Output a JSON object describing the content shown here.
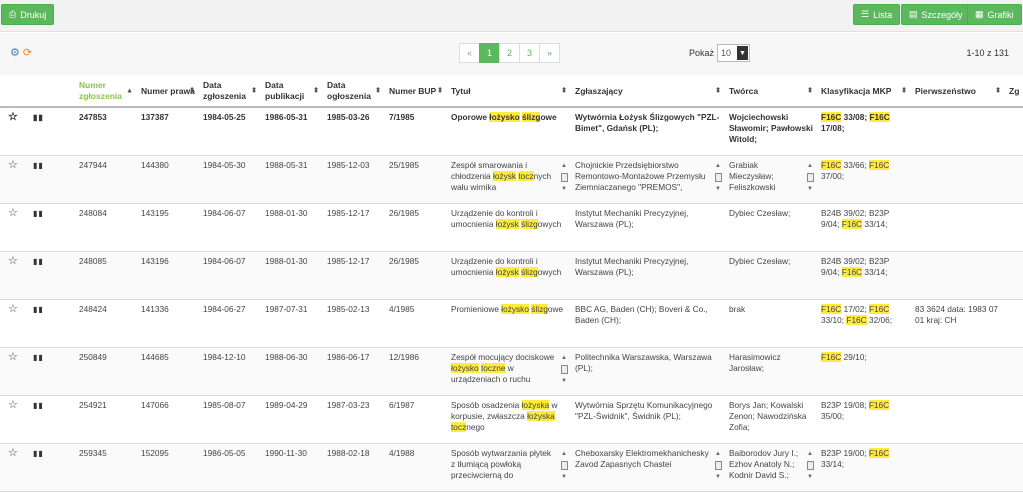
{
  "topbar": {
    "print_label": "Drukuj",
    "list_label": "Lista",
    "details_label": "Szczegóły",
    "charts_label": "Grafiki"
  },
  "pager": {
    "prev": "«",
    "pages": [
      "1",
      "2",
      "3"
    ],
    "next": "»",
    "show_label": "Pokaż",
    "show_value": "10",
    "count_text": "1-10 z 131"
  },
  "columns": {
    "c1": "",
    "c2": "",
    "numer_zgloszenia": "Numer zgłoszenia",
    "numer_prawa": "Numer prawa",
    "data_zgloszenia": "Data zgłoszenia",
    "data_publikacji": "Data publikacji",
    "data_ogloszenia": "Data ogłoszenia",
    "numer_bup": "Numer BUP",
    "tytul": "Tytuł",
    "zglaszajacy": "Zgłaszający",
    "tworca": "Twórca",
    "klasyfikacja": "Klasyfikacja MKP",
    "pierwszenstwo": "Pierwszeństwo",
    "zg": "Zg"
  },
  "rows": [
    {
      "nr_zgl": "247853",
      "nr_prawa": "137387",
      "d_zgl": "1984-05-25",
      "d_pub": "1986-05-31",
      "d_ogl": "1985-03-26",
      "bup": "7/1985",
      "tytul": [
        [
          "Oporowe ",
          0
        ],
        [
          "łożysko",
          1
        ],
        [
          " ",
          0
        ],
        [
          "ślizg",
          1
        ],
        [
          "owe",
          0
        ]
      ],
      "zgl": "Wytwórnia Łożysk Ślizgowych \"PZL-Bimet\", Gdańsk (PL);",
      "tworca": "Wojciechowski Sławomir; Pawłowski Witold;",
      "mkp": [
        [
          "F16C",
          1
        ],
        [
          " 33/08; ",
          0
        ],
        [
          "F16C",
          1
        ],
        [
          " 17/08;",
          0
        ]
      ],
      "pierw": ""
    },
    {
      "nr_zgl": "247944",
      "nr_prawa": "144380",
      "d_zgl": "1984-05-30",
      "d_pub": "1988-05-31",
      "d_ogl": "1985-12-03",
      "bup": "25/1985",
      "tytul": [
        [
          "Zespół smarowania i chłodzenia ",
          0
        ],
        [
          "łożysk",
          1
        ],
        [
          " ",
          0
        ],
        [
          "tocz",
          1
        ],
        [
          "nych wału wirnika",
          0
        ]
      ],
      "zgl": "Chojnickie Przedsiębiorstwo Remontowo-Montażowe Przemysłu Ziemniaczanego \"PREMOS\",",
      "tworca": "Grabiak Mieczysław; Feliszkowski",
      "mkp": [
        [
          "F16C",
          1
        ],
        [
          " 33/66; ",
          0
        ],
        [
          "F16C",
          1
        ],
        [
          " 37/00;",
          0
        ]
      ],
      "pierw": ""
    },
    {
      "nr_zgl": "248084",
      "nr_prawa": "143195",
      "d_zgl": "1984-06-07",
      "d_pub": "1988-01-30",
      "d_ogl": "1985-12-17",
      "bup": "26/1985",
      "tytul": [
        [
          "Urządzenie do kontroli i umocnienia ",
          0
        ],
        [
          "łożysk",
          1
        ],
        [
          " ",
          0
        ],
        [
          "ślizg",
          1
        ],
        [
          "owych",
          0
        ]
      ],
      "zgl": "Instytut Mechaniki Precyzyjnej, Warszawa (PL);",
      "tworca": "Dybiec Czesław;",
      "mkp": [
        [
          "B24B 39/02; B23P 9/04; ",
          0
        ],
        [
          "F16C",
          1
        ],
        [
          " 33/14;",
          0
        ]
      ],
      "pierw": ""
    },
    {
      "nr_zgl": "248085",
      "nr_prawa": "143196",
      "d_zgl": "1984-06-07",
      "d_pub": "1988-01-30",
      "d_ogl": "1985-12-17",
      "bup": "26/1985",
      "tytul": [
        [
          "Urządzenie do kontroli i umocnienia ",
          0
        ],
        [
          "łożysk",
          1
        ],
        [
          " ",
          0
        ],
        [
          "ślizg",
          1
        ],
        [
          "owych",
          0
        ]
      ],
      "zgl": "Instytut Mechaniki Precyzyjnej, Warszawa (PL);",
      "tworca": "Dybiec Czesław;",
      "mkp": [
        [
          "B24B 39/02; B23P 9/04; ",
          0
        ],
        [
          "F16C",
          1
        ],
        [
          " 33/14;",
          0
        ]
      ],
      "pierw": ""
    },
    {
      "nr_zgl": "248424",
      "nr_prawa": "141336",
      "d_zgl": "1984-06-27",
      "d_pub": "1987-07-31",
      "d_ogl": "1985-02-13",
      "bup": "4/1985",
      "tytul": [
        [
          "Promieniowe ",
          0
        ],
        [
          "łożysko",
          1
        ],
        [
          " ",
          0
        ],
        [
          "ślizg",
          1
        ],
        [
          "owe",
          0
        ]
      ],
      "zgl": "BBC AG, Baden (CH); Boveri & Co., Baden (CH);",
      "tworca": "brak",
      "mkp": [
        [
          "F16C",
          1
        ],
        [
          " 17/02; ",
          0
        ],
        [
          "F16C",
          1
        ],
        [
          " 33/10; ",
          0
        ],
        [
          "F16C",
          1
        ],
        [
          " 32/06;",
          0
        ]
      ],
      "pierw": "83 3624 data: 1983 07 01 kraj: CH"
    },
    {
      "nr_zgl": "250849",
      "nr_prawa": "144685",
      "d_zgl": "1984-12-10",
      "d_pub": "1988-06-30",
      "d_ogl": "1986-06-17",
      "bup": "12/1986",
      "tytul": [
        [
          "Zespół mocujący dociskowe ",
          0
        ],
        [
          "łożysko",
          1
        ],
        [
          " ",
          0
        ],
        [
          "toczne",
          1
        ],
        [
          " w urządzeniach o ruchu",
          0
        ]
      ],
      "zgl": "Politechnika Warszawska, Warszawa (PL);",
      "tworca": "Harasimowicz Jarosław;",
      "mkp": [
        [
          "F16C",
          1
        ],
        [
          " 29/10;",
          0
        ]
      ],
      "pierw": ""
    },
    {
      "nr_zgl": "254921",
      "nr_prawa": "147066",
      "d_zgl": "1985-08-07",
      "d_pub": "1989-04-29",
      "d_ogl": "1987-03-23",
      "bup": "6/1987",
      "tytul": [
        [
          "Sposób osadzenia ",
          0
        ],
        [
          "łożyska",
          1
        ],
        [
          " w korpusie, zwłaszcza ",
          0
        ],
        [
          "łożyska",
          1
        ],
        [
          " ",
          0
        ],
        [
          "tocz",
          1
        ],
        [
          "nego",
          0
        ]
      ],
      "zgl": "Wytwórnia Sprzętu Komunikacyjnego \"PZL-Świdnik\", Świdnik (PL);",
      "tworca": "Borys Jan; Kowalski Zenon; Nawodzińska Zofia;",
      "mkp": [
        [
          "B23P 19/08; ",
          0
        ],
        [
          "F16C",
          1
        ],
        [
          " 35/00;",
          0
        ]
      ],
      "pierw": ""
    },
    {
      "nr_zgl": "259345",
      "nr_prawa": "152095",
      "d_zgl": "1986-05-05",
      "d_pub": "1990-11-30",
      "d_ogl": "1988-02-18",
      "bup": "4/1988",
      "tytul": [
        [
          "Sposób wytwarzania płytek z tłumiącą powłoką przeciwcierną do",
          0
        ]
      ],
      "zgl": "Cheboxarsky Elektromekhanichesky Zavod Zapasnych Chastei",
      "tworca": "Baiborodov Jury I.; Ezhov Anatoly N.; Kodnir David S.;",
      "mkp": [
        [
          "B23P 19/00; ",
          0
        ],
        [
          "F16C",
          1
        ],
        [
          " 33/14;",
          0
        ]
      ],
      "pierw": ""
    }
  ],
  "scroll_cells": {
    "1": [
      "tytul",
      "zgl",
      "tworca"
    ],
    "5": [
      "tytul"
    ],
    "7": [
      "tytul",
      "zgl",
      "tworca"
    ]
  },
  "colors": {
    "accent": "#5cb85c",
    "highlight": "#ffeb3b"
  }
}
